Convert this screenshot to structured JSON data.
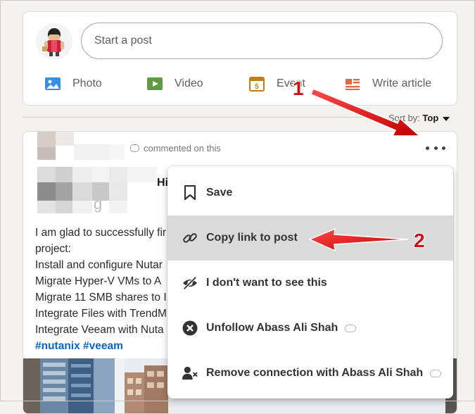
{
  "composer": {
    "start_post_label": "Start a post",
    "actions": [
      {
        "label": "Photo",
        "icon": "photo-icon"
      },
      {
        "label": "Video",
        "icon": "video-icon"
      },
      {
        "label": "Event",
        "icon": "calendar-icon"
      },
      {
        "label": "Write article",
        "icon": "article-icon"
      }
    ]
  },
  "sort": {
    "prefix": "Sort by:",
    "value": "Top"
  },
  "post": {
    "activity": "commented on this",
    "author_fragment": "Hi",
    "body_lines": [
      "I am glad to successfully fir",
      "project:",
      "Install and configure Nutar",
      "Migrate Hyper-V VMs to A",
      "Migrate 11 SMB shares to I",
      "Integrate Files with TrendM",
      "Integrate Veeam with Nuta"
    ],
    "hashtags": "#nutanix #veeam"
  },
  "menu": {
    "items": [
      {
        "label": "Save",
        "icon": "bookmark-icon"
      },
      {
        "label": "Copy link to post",
        "icon": "link-icon"
      },
      {
        "label": "I don't want to see this",
        "icon": "eye-slash-icon"
      },
      {
        "label": "Unfollow Abass Ali Shah",
        "icon": "close-circle-icon"
      },
      {
        "label": "Remove connection with Abass Ali Shah",
        "icon": "remove-person-icon"
      }
    ]
  },
  "annotations": {
    "step1": "1",
    "step2": "2"
  },
  "colors": {
    "accent": "#0a66c2",
    "annotation": "#cc1212",
    "highlight": "#dadada"
  }
}
